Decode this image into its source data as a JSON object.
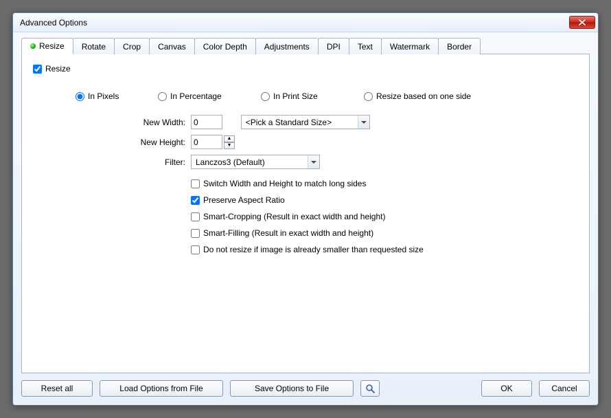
{
  "window": {
    "title": "Advanced Options"
  },
  "tabs": [
    {
      "label": "Resize",
      "active": true,
      "dot": true
    },
    {
      "label": "Rotate"
    },
    {
      "label": "Crop"
    },
    {
      "label": "Canvas"
    },
    {
      "label": "Color Depth"
    },
    {
      "label": "Adjustments"
    },
    {
      "label": "DPI"
    },
    {
      "label": "Text"
    },
    {
      "label": "Watermark"
    },
    {
      "label": "Border"
    }
  ],
  "resize": {
    "enable_label": "Resize",
    "enable_checked": true,
    "modes": {
      "pixels": "In Pixels",
      "percentage": "In Percentage",
      "print": "In Print Size",
      "oneside": "Resize based on one side",
      "selected": "pixels"
    },
    "width_label": "New Width:",
    "width_value": "0",
    "height_label": "New Height:",
    "height_value": "0",
    "standard_size": "<Pick a Standard Size>",
    "filter_label": "Filter:",
    "filter_value": "Lanczos3 (Default)",
    "options": {
      "switch_sides": {
        "label": "Switch Width and Height to match long sides",
        "checked": false
      },
      "preserve_ratio": {
        "label": "Preserve Aspect Ratio",
        "checked": true
      },
      "smart_crop": {
        "label": "Smart-Cropping (Result in exact width and height)",
        "checked": false
      },
      "smart_fill": {
        "label": "Smart-Filling (Result in exact width and height)",
        "checked": false
      },
      "no_upscale": {
        "label": "Do not resize if image is already smaller than requested size",
        "checked": false
      }
    }
  },
  "buttons": {
    "reset": "Reset all",
    "load": "Load Options from File",
    "save": "Save Options to File",
    "ok": "OK",
    "cancel": "Cancel"
  }
}
